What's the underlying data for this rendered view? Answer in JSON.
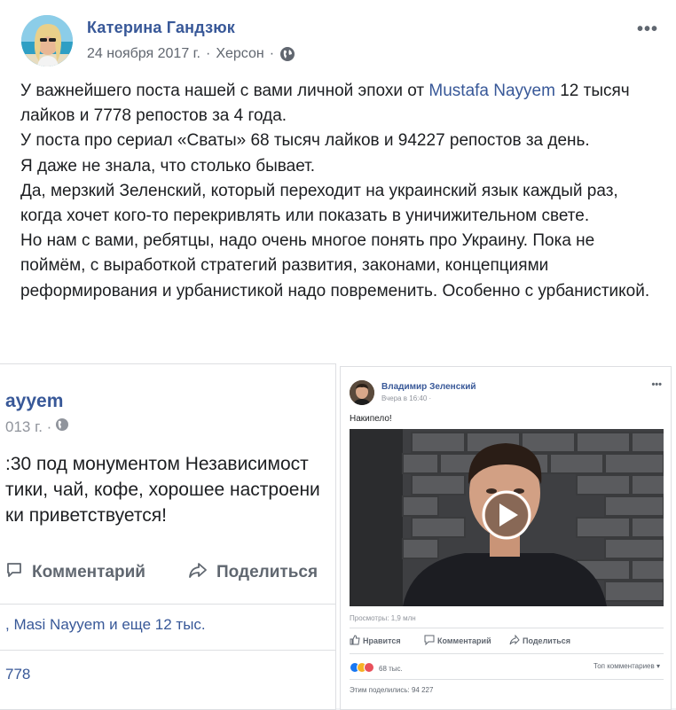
{
  "post": {
    "author": "Катерина Гандзюк",
    "date": "24 ноября 2017 г.",
    "separator": "·",
    "location": "Херсон",
    "separator2": "·",
    "more": "•••",
    "paragraphs": [
      {
        "before": "У важнейшего поста нашей с вами личной эпохи от ",
        "link": "Mustafa Nayyem",
        "after": " 12 тысяч лайков и 7778 репостов за 4 года."
      },
      {
        "text": "У поста про сериал «Сваты» 68 тысяч лайков и 94227 репостов за день."
      },
      {
        "text": "Я даже не знала, что столько бывает."
      },
      {
        "text": "Да, мерзкий Зеленский, который переходит на украинский язык каждый раз, когда хочет кого-то перекривлять или показать в уничижительном свете."
      },
      {
        "text": "Но нам с вами, ребятцы, надо очень многое понять про Украину. Пока не поймём, с выработкой стратегий развития, законами, концепциями реформирования и урбанистикой надо повременить. Особенно с урбанистикой."
      }
    ]
  },
  "left_card": {
    "name": "ayyem",
    "date": "013 г. ·",
    "lines": [
      ":30 под монументом Независимост",
      "тики, чай, кофе, хорошее настроени",
      "ки приветствуется!"
    ],
    "comment_label": "Комментарий",
    "share_label": "Поделиться",
    "likes": ", Masi Nayyem и еще 12 тыс.",
    "shares": "778"
  },
  "right_card": {
    "name": "Владимир Зеленский",
    "meta": "Вчера в 16:40 ·",
    "more": "•••",
    "text": "Накипело!",
    "views": "Просмотры: 1,9 млн",
    "like_label": "Нравится",
    "comment_label": "Комментарий",
    "share_label": "Поделиться",
    "reactions_count": "68 тыс.",
    "top_comments": "Топ комментариев ▾",
    "shared": "Этим поделились: 94 227"
  },
  "colors": {
    "link": "#385898",
    "text": "#1c1e21",
    "muted": "#616770"
  }
}
